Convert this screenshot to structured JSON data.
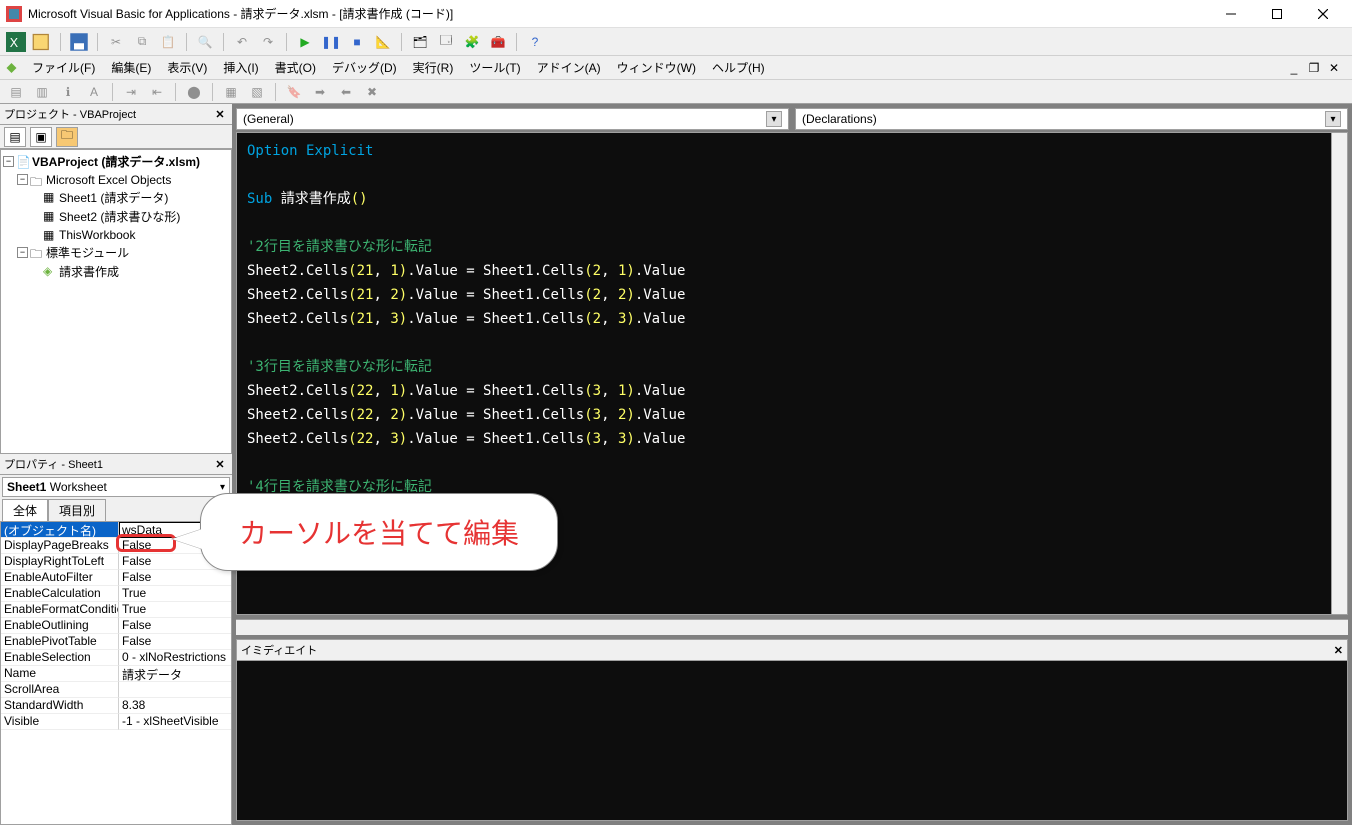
{
  "title": "Microsoft Visual Basic for Applications - 請求データ.xlsm - [請求書作成 (コード)]",
  "menus": {
    "file": "ファイル(F)",
    "edit": "編集(E)",
    "view": "表示(V)",
    "insert": "挿入(I)",
    "format": "書式(O)",
    "debug": "デバッグ(D)",
    "run": "実行(R)",
    "tools": "ツール(T)",
    "addins": "アドイン(A)",
    "window": "ウィンドウ(W)",
    "help": "ヘルプ(H)"
  },
  "project_panel_title": "プロジェクト - VBAProject",
  "tree": {
    "root": "VBAProject (請求データ.xlsm)",
    "excel_objects": "Microsoft Excel Objects",
    "sheet1": "Sheet1 (請求データ)",
    "sheet2": "Sheet2 (請求書ひな形)",
    "thisworkbook": "ThisWorkbook",
    "std_modules": "標準モジュール",
    "module1": "請求書作成"
  },
  "props_panel_title": "プロパティ - Sheet1",
  "props_combo": {
    "obj": "Sheet1",
    "type": "Worksheet"
  },
  "props_tabs": {
    "zen": "全体",
    "koumoku": "項目別"
  },
  "props": [
    {
      "k": "(オブジェクト名)",
      "v": "wsData",
      "sel": true
    },
    {
      "k": "DisplayPageBreaks",
      "v": "False"
    },
    {
      "k": "DisplayRightToLeft",
      "v": "False"
    },
    {
      "k": "EnableAutoFilter",
      "v": "False"
    },
    {
      "k": "EnableCalculation",
      "v": "True"
    },
    {
      "k": "EnableFormatConditio",
      "v": "True"
    },
    {
      "k": "EnableOutlining",
      "v": "False"
    },
    {
      "k": "EnablePivotTable",
      "v": "False"
    },
    {
      "k": "EnableSelection",
      "v": "0 - xlNoRestrictions"
    },
    {
      "k": "Name",
      "v": "請求データ"
    },
    {
      "k": "ScrollArea",
      "v": ""
    },
    {
      "k": "StandardWidth",
      "v": "8.38"
    },
    {
      "k": "Visible",
      "v": "-1 - xlSheetVisible"
    }
  ],
  "code_dropdowns": {
    "left": "(General)",
    "right": "(Declarations)"
  },
  "code_lines": [
    {
      "t": "kw",
      "s": "Option Explicit"
    },
    {
      "t": "",
      "s": ""
    },
    {
      "t": "sub",
      "s": "Sub 請求書作成()"
    },
    {
      "t": "",
      "s": ""
    },
    {
      "t": "cm",
      "s": "'2行目を請求書ひな形に転記"
    },
    {
      "t": "code",
      "s": "Sheet2.Cells(21, 1).Value = Sheet1.Cells(2, 1).Value"
    },
    {
      "t": "code",
      "s": "Sheet2.Cells(21, 2).Value = Sheet1.Cells(2, 2).Value"
    },
    {
      "t": "code",
      "s": "Sheet2.Cells(21, 3).Value = Sheet1.Cells(2, 3).Value"
    },
    {
      "t": "",
      "s": ""
    },
    {
      "t": "cm",
      "s": "'3行目を請求書ひな形に転記"
    },
    {
      "t": "code",
      "s": "Sheet2.Cells(22, 1).Value = Sheet1.Cells(3, 1).Value"
    },
    {
      "t": "code",
      "s": "Sheet2.Cells(22, 2).Value = Sheet1.Cells(3, 2).Value"
    },
    {
      "t": "code",
      "s": "Sheet2.Cells(22, 3).Value = Sheet1.Cells(3, 3).Value"
    },
    {
      "t": "",
      "s": ""
    },
    {
      "t": "cm",
      "s": "'4行目を請求書ひな形に転記"
    }
  ],
  "immediate_title": "イミディエイト",
  "callout_text": "カーソルを当てて編集"
}
